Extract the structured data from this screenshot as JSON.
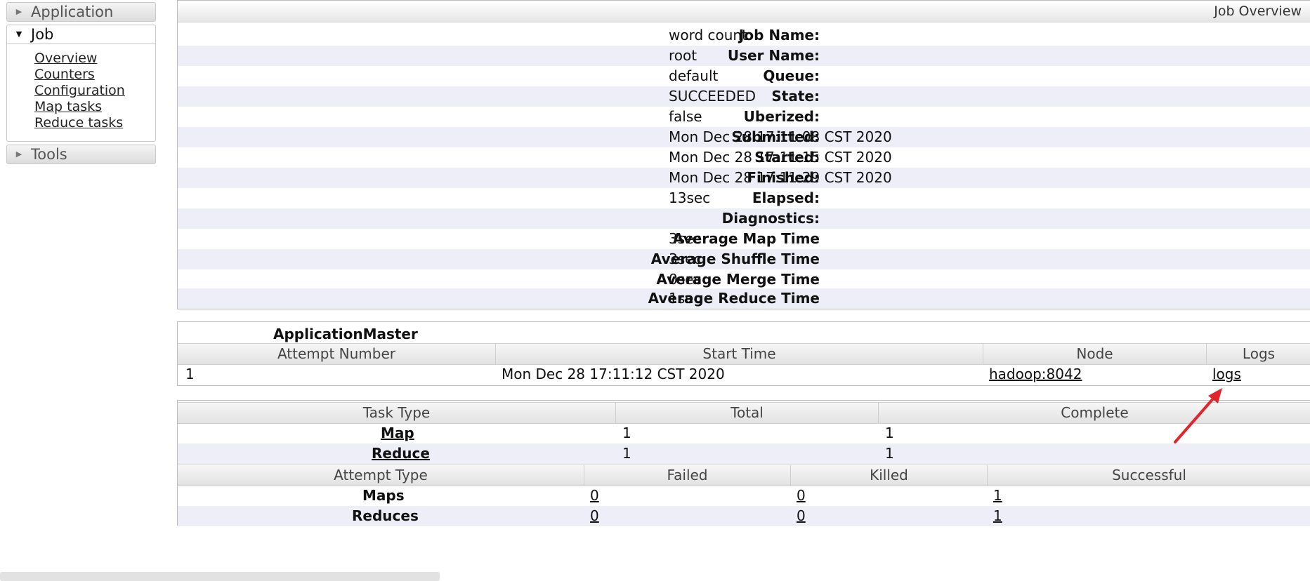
{
  "sidebar": {
    "application": "Application",
    "job": "Job",
    "job_links": [
      "Overview",
      "Counters",
      "Configuration",
      "Map tasks",
      "Reduce tasks"
    ],
    "tools": "Tools"
  },
  "overview": {
    "title": "Job Overview",
    "rows": [
      {
        "key": "Job Name:",
        "value": "word count"
      },
      {
        "key": "User Name:",
        "value": "root"
      },
      {
        "key": "Queue:",
        "value": "default"
      },
      {
        "key": "State:",
        "value": "SUCCEEDED"
      },
      {
        "key": "Uberized:",
        "value": "false"
      },
      {
        "key": "Submitted:",
        "value": "Mon Dec 28 17:11:08 CST 2020"
      },
      {
        "key": "Started:",
        "value": "Mon Dec 28 17:11:15 CST 2020"
      },
      {
        "key": "Finished:",
        "value": "Mon Dec 28 17:11:29 CST 2020"
      },
      {
        "key": "Elapsed:",
        "value": "13sec"
      },
      {
        "key": "Diagnostics:",
        "value": ""
      },
      {
        "key": "Average Map Time",
        "value": "3sec"
      },
      {
        "key": "Average Shuffle Time",
        "value": "3sec"
      },
      {
        "key": "Average Merge Time",
        "value": "0sec"
      },
      {
        "key": "Average Reduce Time",
        "value": "1sec"
      }
    ]
  },
  "application_master": {
    "title": "ApplicationMaster",
    "headers": [
      "Attempt Number",
      "Start Time",
      "Node",
      "Logs"
    ],
    "row": {
      "attempt": "1",
      "start_time": "Mon Dec 28 17:11:12 CST 2020",
      "node": "hadoop:8042",
      "logs": "logs"
    }
  },
  "tasks": {
    "headers": [
      "Task Type",
      "Total",
      "Complete"
    ],
    "rows": [
      {
        "type": "Map",
        "total": "1",
        "complete": "1"
      },
      {
        "type": "Reduce",
        "total": "1",
        "complete": "1"
      }
    ]
  },
  "attempts": {
    "headers": [
      "Attempt Type",
      "Failed",
      "Killed",
      "Successful"
    ],
    "rows": [
      {
        "type": "Maps",
        "failed": "0",
        "killed": "0",
        "successful": "1"
      },
      {
        "type": "Reduces",
        "failed": "0",
        "killed": "0",
        "successful": "1"
      }
    ]
  },
  "colors": {
    "alt_row": "#eeeef8",
    "arrow": "#e0252b",
    "header_bg": "#e6e6e6"
  }
}
